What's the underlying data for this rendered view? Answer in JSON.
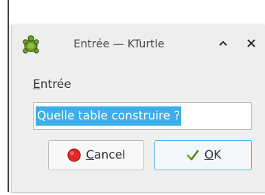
{
  "window": {
    "title": "Entrée — KTurtle",
    "app_icon": "kturtle-turtle-icon",
    "buttons": {
      "maximize_icon": "chevron-up-icon",
      "close_icon": "close-icon"
    }
  },
  "form": {
    "label_mnemonic": "E",
    "label_rest": "ntrée",
    "input_value": "Quelle table construire ?"
  },
  "buttons": {
    "cancel": {
      "mnemonic": "C",
      "rest": "ancel",
      "icon": "cancel-red-dot-icon"
    },
    "ok": {
      "mnemonic": "O",
      "rest": "K",
      "icon": "ok-check-icon"
    }
  },
  "colors": {
    "selection": "#3daee9",
    "focus_border": "#3daee9",
    "cancel_icon": "#e22a2a"
  }
}
